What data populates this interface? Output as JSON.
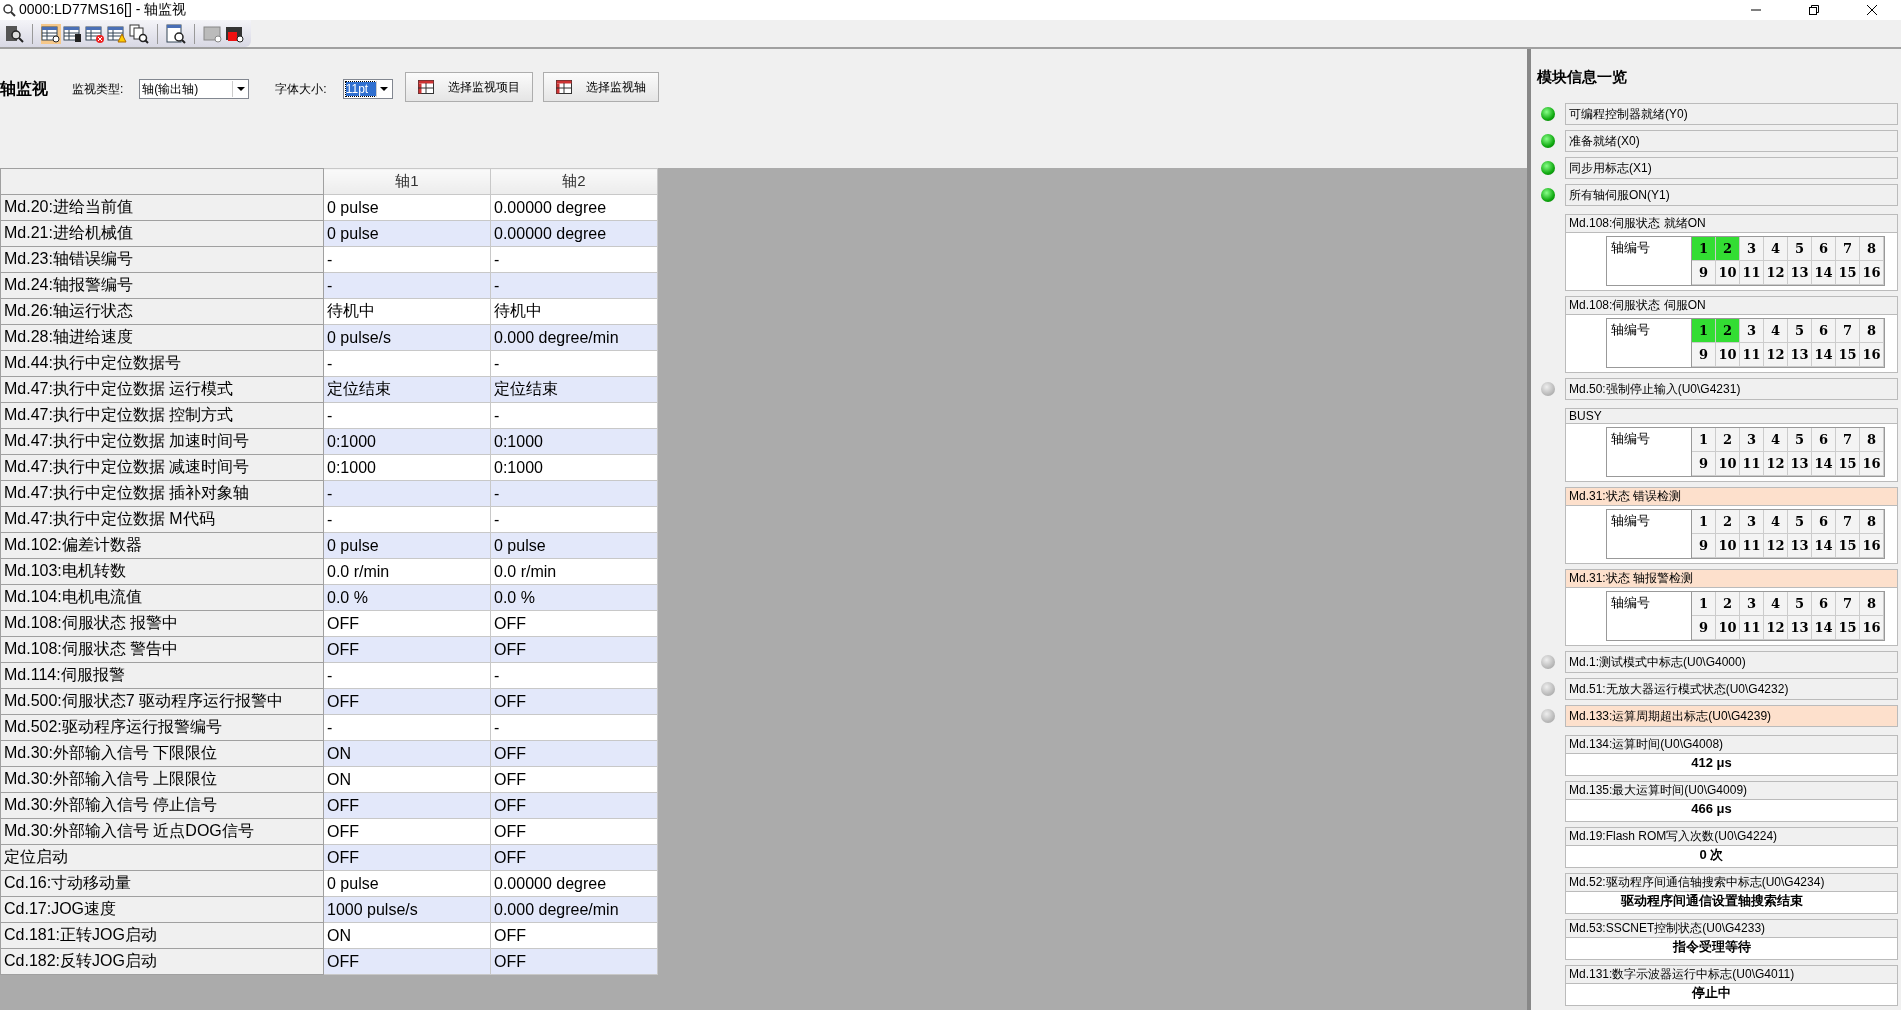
{
  "window": {
    "title": "0000:LD77MS16[] - 轴监视"
  },
  "header": {
    "title": "轴监视",
    "monitor_type": {
      "label": "监视类型:",
      "value": "轴(输出轴)"
    },
    "font_size": {
      "label": "字体大小:",
      "value": "11pt",
      "focused": true
    },
    "buttons": [
      "选择监视项目",
      "选择监视轴"
    ]
  },
  "table": {
    "columns": [
      "轴1",
      "轴2"
    ],
    "rows": [
      {
        "label": "Md.20:进给当前值",
        "values": [
          "0 pulse",
          "0.00000 degree"
        ]
      },
      {
        "label": "Md.21:进给机械值",
        "values": [
          "0 pulse",
          "0.00000 degree"
        ]
      },
      {
        "label": "Md.23:轴错误编号",
        "values": [
          "-",
          "-"
        ]
      },
      {
        "label": "Md.24:轴报警编号",
        "values": [
          "-",
          "-"
        ]
      },
      {
        "label": "Md.26:轴运行状态",
        "values": [
          "待机中",
          "待机中"
        ]
      },
      {
        "label": "Md.28:轴进给速度",
        "values": [
          "0 pulse/s",
          "0.000 degree/min"
        ]
      },
      {
        "label": "Md.44:执行中定位数据号",
        "values": [
          "-",
          "-"
        ]
      },
      {
        "label": "Md.47:执行中定位数据 运行模式",
        "values": [
          "定位结束",
          "定位结束"
        ]
      },
      {
        "label": "Md.47:执行中定位数据 控制方式",
        "values": [
          "-",
          "-"
        ]
      },
      {
        "label": "Md.47:执行中定位数据 加速时间号",
        "values": [
          "0:1000",
          "0:1000"
        ]
      },
      {
        "label": "Md.47:执行中定位数据 减速时间号",
        "values": [
          "0:1000",
          "0:1000"
        ]
      },
      {
        "label": "Md.47:执行中定位数据 插补对象轴",
        "values": [
          "-",
          "-"
        ]
      },
      {
        "label": "Md.47:执行中定位数据 M代码",
        "values": [
          "-",
          "-"
        ]
      },
      {
        "label": "Md.102:偏差计数器",
        "values": [
          "0 pulse",
          "0 pulse"
        ]
      },
      {
        "label": "Md.103:电机转数",
        "values": [
          "0.0 r/min",
          "0.0 r/min"
        ]
      },
      {
        "label": "Md.104:电机电流值",
        "values": [
          "0.0 %",
          "0.0 %"
        ]
      },
      {
        "label": "Md.108:伺服状态 报警中",
        "values": [
          "OFF",
          "OFF"
        ]
      },
      {
        "label": "Md.108:伺服状态 警告中",
        "values": [
          "OFF",
          "OFF"
        ]
      },
      {
        "label": "Md.114:伺服报警",
        "values": [
          "-",
          "-"
        ]
      },
      {
        "label": "Md.500:伺服状态7 驱动程序运行报警中",
        "values": [
          "OFF",
          "OFF"
        ]
      },
      {
        "label": "Md.502:驱动程序运行报警编号",
        "values": [
          "-",
          "-"
        ]
      },
      {
        "label": "Md.30:外部输入信号 下限限位",
        "values": [
          "ON",
          "OFF"
        ]
      },
      {
        "label": "Md.30:外部输入信号 上限限位",
        "values": [
          "ON",
          "OFF"
        ]
      },
      {
        "label": "Md.30:外部输入信号 停止信号",
        "values": [
          "OFF",
          "OFF"
        ]
      },
      {
        "label": "Md.30:外部输入信号 近点DOG信号",
        "values": [
          "OFF",
          "OFF"
        ]
      },
      {
        "label": "定位启动",
        "values": [
          "OFF",
          "OFF"
        ]
      },
      {
        "label": "Cd.16:寸动移动量",
        "values": [
          "0 pulse",
          "0.00000 degree"
        ]
      },
      {
        "label": "Cd.17:JOG速度",
        "values": [
          "1000 pulse/s",
          "0.000 degree/min"
        ]
      },
      {
        "label": "Cd.181:正转JOG启动",
        "values": [
          "ON",
          "OFF"
        ]
      },
      {
        "label": "Cd.182:反转JOG启动",
        "values": [
          "OFF",
          "OFF"
        ]
      }
    ]
  },
  "module_panel": {
    "title": "模块信息一览",
    "items": [
      {
        "kind": "lamp",
        "label": "可编程控制器就绪(Y0)",
        "on": true,
        "alert": false
      },
      {
        "kind": "lamp",
        "label": "准备就绪(X0)",
        "on": true,
        "alert": false
      },
      {
        "kind": "lamp",
        "label": "同步用标志(X1)",
        "on": true,
        "alert": false
      },
      {
        "kind": "lamp",
        "label": "所有轴伺服ON(Y1)",
        "on": true,
        "alert": false
      },
      {
        "kind": "axis_grid",
        "label": "Md.108:伺服状态 就绪ON",
        "alert": false,
        "axis_label": "轴编号",
        "axes": [
          {
            "number": "1",
            "on": true
          },
          {
            "number": "2",
            "on": true
          },
          {
            "number": "3",
            "on": false
          },
          {
            "number": "4",
            "on": false
          },
          {
            "number": "5",
            "on": false
          },
          {
            "number": "6",
            "on": false
          },
          {
            "number": "7",
            "on": false
          },
          {
            "number": "8",
            "on": false
          },
          {
            "number": "9",
            "on": false
          },
          {
            "number": "10",
            "on": false
          },
          {
            "number": "11",
            "on": false
          },
          {
            "number": "12",
            "on": false
          },
          {
            "number": "13",
            "on": false
          },
          {
            "number": "14",
            "on": false
          },
          {
            "number": "15",
            "on": false
          },
          {
            "number": "16",
            "on": false
          }
        ]
      },
      {
        "kind": "axis_grid",
        "label": "Md.108:伺服状态 伺服ON",
        "alert": false,
        "axis_label": "轴编号",
        "axes": [
          {
            "number": "1",
            "on": true
          },
          {
            "number": "2",
            "on": true
          },
          {
            "number": "3",
            "on": false
          },
          {
            "number": "4",
            "on": false
          },
          {
            "number": "5",
            "on": false
          },
          {
            "number": "6",
            "on": false
          },
          {
            "number": "7",
            "on": false
          },
          {
            "number": "8",
            "on": false
          },
          {
            "number": "9",
            "on": false
          },
          {
            "number": "10",
            "on": false
          },
          {
            "number": "11",
            "on": false
          },
          {
            "number": "12",
            "on": false
          },
          {
            "number": "13",
            "on": false
          },
          {
            "number": "14",
            "on": false
          },
          {
            "number": "15",
            "on": false
          },
          {
            "number": "16",
            "on": false
          }
        ]
      },
      {
        "kind": "lamp",
        "label": "Md.50:强制停止输入(U0\\G4231)",
        "on": false,
        "alert": false
      },
      {
        "kind": "axis_grid",
        "label": "BUSY",
        "alert": false,
        "axis_label": "轴编号",
        "axes": [
          {
            "number": "1",
            "on": false
          },
          {
            "number": "2",
            "on": false
          },
          {
            "number": "3",
            "on": false
          },
          {
            "number": "4",
            "on": false
          },
          {
            "number": "5",
            "on": false
          },
          {
            "number": "6",
            "on": false
          },
          {
            "number": "7",
            "on": false
          },
          {
            "number": "8",
            "on": false
          },
          {
            "number": "9",
            "on": false
          },
          {
            "number": "10",
            "on": false
          },
          {
            "number": "11",
            "on": false
          },
          {
            "number": "12",
            "on": false
          },
          {
            "number": "13",
            "on": false
          },
          {
            "number": "14",
            "on": false
          },
          {
            "number": "15",
            "on": false
          },
          {
            "number": "16",
            "on": false
          }
        ]
      },
      {
        "kind": "axis_grid",
        "label": "Md.31:状态 错误检测",
        "alert": true,
        "axis_label": "轴编号",
        "axes": [
          {
            "number": "1",
            "on": false
          },
          {
            "number": "2",
            "on": false
          },
          {
            "number": "3",
            "on": false
          },
          {
            "number": "4",
            "on": false
          },
          {
            "number": "5",
            "on": false
          },
          {
            "number": "6",
            "on": false
          },
          {
            "number": "7",
            "on": false
          },
          {
            "number": "8",
            "on": false
          },
          {
            "number": "9",
            "on": false
          },
          {
            "number": "10",
            "on": false
          },
          {
            "number": "11",
            "on": false
          },
          {
            "number": "12",
            "on": false
          },
          {
            "number": "13",
            "on": false
          },
          {
            "number": "14",
            "on": false
          },
          {
            "number": "15",
            "on": false
          },
          {
            "number": "16",
            "on": false
          }
        ]
      },
      {
        "kind": "axis_grid",
        "label": "Md.31:状态 轴报警检测",
        "alert": true,
        "axis_label": "轴编号",
        "axes": [
          {
            "number": "1",
            "on": false
          },
          {
            "number": "2",
            "on": false
          },
          {
            "number": "3",
            "on": false
          },
          {
            "number": "4",
            "on": false
          },
          {
            "number": "5",
            "on": false
          },
          {
            "number": "6",
            "on": false
          },
          {
            "number": "7",
            "on": false
          },
          {
            "number": "8",
            "on": false
          },
          {
            "number": "9",
            "on": false
          },
          {
            "number": "10",
            "on": false
          },
          {
            "number": "11",
            "on": false
          },
          {
            "number": "12",
            "on": false
          },
          {
            "number": "13",
            "on": false
          },
          {
            "number": "14",
            "on": false
          },
          {
            "number": "15",
            "on": false
          },
          {
            "number": "16",
            "on": false
          }
        ]
      },
      {
        "kind": "lamp",
        "label": "Md.1:测试模式中标志(U0\\G4000)",
        "on": false,
        "alert": false
      },
      {
        "kind": "lamp",
        "label": "Md.51:无放大器运行模式状态(U0\\G4232)",
        "on": false,
        "alert": false
      },
      {
        "kind": "lamp",
        "label": "Md.133:运算周期超出标志(U0\\G4239)",
        "on": false,
        "alert": true
      },
      {
        "kind": "value",
        "label": "Md.134:运算时间(U0\\G4008)",
        "value": "412 μs",
        "alert": false
      },
      {
        "kind": "value",
        "label": "Md.135:最大运算时间(U0\\G4009)",
        "value": "466 μs",
        "alert": false
      },
      {
        "kind": "value",
        "label": "Md.19:Flash ROM写入次数(U0\\G4224)",
        "value": "0 次",
        "alert": false
      },
      {
        "kind": "value",
        "label": "Md.52:驱动程序间通信轴搜索中标志(U0\\G4234)",
        "value": "驱动程序间通信设置轴搜索结束",
        "alert": false
      },
      {
        "kind": "value",
        "label": "Md.53:SSCNET控制状态(U0\\G4233)",
        "value": "指令受理等待",
        "alert": false
      },
      {
        "kind": "value",
        "label": "Md.131:数字示波器运行中标志(U0\\G4011)",
        "value": "停止中",
        "alert": false
      }
    ]
  }
}
